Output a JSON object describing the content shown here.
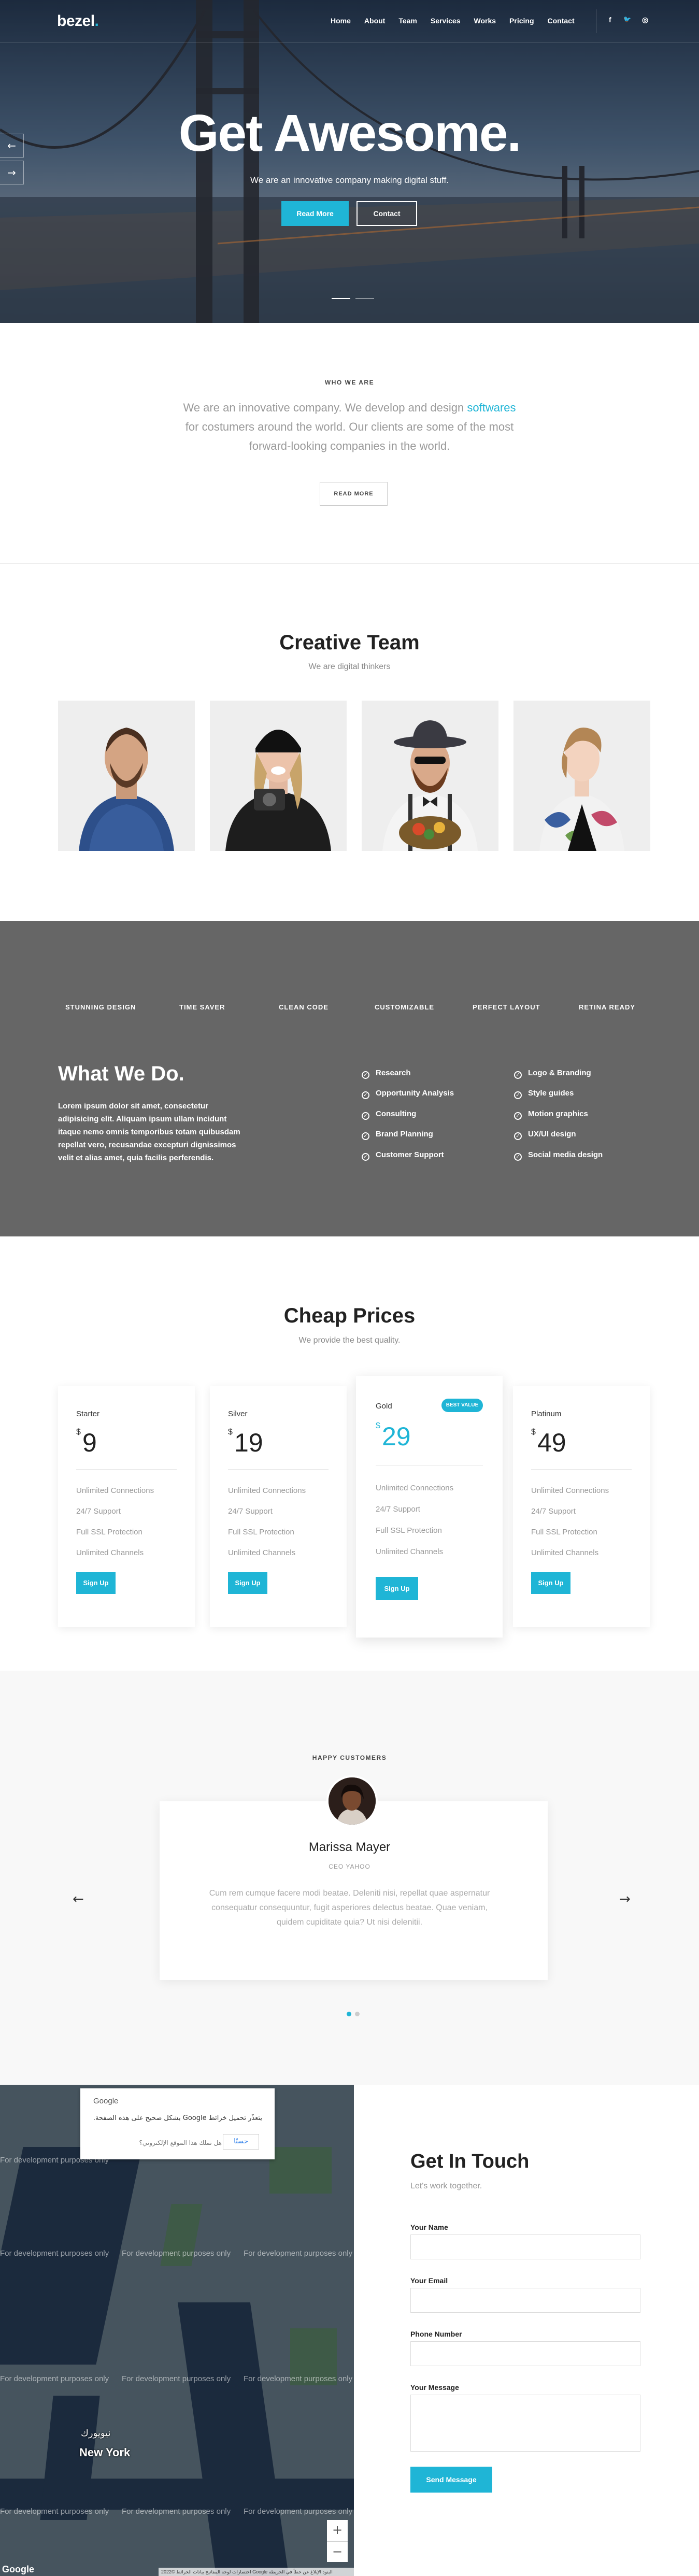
{
  "nav": {
    "logo": "bezel",
    "logo_dot": ".",
    "items": [
      {
        "label": "Home"
      },
      {
        "label": "About"
      },
      {
        "label": "Team"
      },
      {
        "label": "Services"
      },
      {
        "label": "Works"
      },
      {
        "label": "Pricing"
      },
      {
        "label": "Contact"
      }
    ],
    "social": [
      {
        "icon": "facebook-icon",
        "glyph": "f"
      },
      {
        "icon": "twitter-icon",
        "glyph": "🐦"
      },
      {
        "icon": "instagram-icon",
        "glyph": "◎"
      }
    ]
  },
  "hero": {
    "title": "Get Awesome.",
    "subtitle": "We are an innovative company making digital stuff.",
    "read_more": "Read More",
    "contact": "Contact",
    "prev_arrow": "←",
    "next_arrow": "→",
    "slides": 2,
    "active_slide": 1
  },
  "about": {
    "label": "WHO WE ARE",
    "text_before": "We are an innovative company. We develop and design ",
    "highlight": "softwares",
    "text_after": " for costumers around the world. Our clients are some of the most forward-looking companies in the world.",
    "read_more": "READ MORE"
  },
  "team": {
    "title": "Creative Team",
    "subtitle": "We are digital thinkers",
    "members": [
      {
        "photo": "man in blue plaid shirt"
      },
      {
        "photo": "woman with beanie and camera"
      },
      {
        "photo": "bearded man with hat and sunglasses"
      },
      {
        "photo": "woman in floral top"
      }
    ]
  },
  "features": {
    "tabs": [
      "STUNNING DESIGN",
      "TIME SAVER",
      "CLEAN CODE",
      "CUSTOMIZABLE",
      "PERFECT LAYOUT",
      "RETINA READY"
    ],
    "title": "What We Do.",
    "text": "Lorem ipsum dolor sit amet, consectetur adipisicing elit. Aliquam ipsum ullam incidunt itaque nemo omnis temporibus totam quibusdam repellat vero, recusandae excepturi dignissimos velit et alias amet, quia facilis perferendis.",
    "list_left": [
      "Research",
      "Opportunity Analysis",
      "Consulting",
      "Brand Planning",
      "Customer Support"
    ],
    "list_right": [
      "Logo & Branding",
      "Style guides",
      "Motion graphics",
      "UX/UI design",
      "Social media design"
    ],
    "check_glyph": "✓",
    "bg_color": "#666666"
  },
  "pricing": {
    "title": "Cheap Prices",
    "subtitle": "We provide the best quality.",
    "plans": [
      {
        "name": "Starter",
        "currency": "$",
        "price": "9",
        "features": [
          "Unlimited Connections",
          "24/7 Support",
          "Full SSL Protection",
          "Unlimited Channels"
        ],
        "button": "Sign Up"
      },
      {
        "name": "Silver",
        "currency": "$",
        "price": "19",
        "features": [
          "Unlimited Connections",
          "24/7 Support",
          "Full SSL Protection",
          "Unlimited Channels"
        ],
        "button": "Sign Up"
      },
      {
        "name": "Gold",
        "currency": "$",
        "price": "29",
        "badge": "BEST VALUE",
        "features": [
          "Unlimited Connections",
          "24/7 Support",
          "Full SSL Protection",
          "Unlimited Channels"
        ],
        "button": "Sign Up"
      },
      {
        "name": "Platinum",
        "currency": "$",
        "price": "49",
        "features": [
          "Unlimited Connections",
          "24/7 Support",
          "Full SSL Protection",
          "Unlimited Channels"
        ],
        "button": "Sign Up"
      }
    ],
    "accent": "#1fb5d6"
  },
  "testimonial": {
    "label": "HAPPY CUSTOMERS",
    "name": "Marissa Mayer",
    "role": "CEO YAHOO",
    "quote": "Cum rem cumque facere modi beatae. Deleniti nisi, repellat quae aspernatur consequatur consequuntur, fugit asperiores delectus beatae. Quae veniam, quidem cupiditate quia? Ut nisi delenitii.",
    "prev": "←",
    "next": "→",
    "slides": 2,
    "active_slide": 1
  },
  "map": {
    "dialog_brand": "Google",
    "dialog_message": "يتعذّر تحميل خرائط Google بشكل صحيح على هذه الصفحة.",
    "dialog_link": "هل تملك هذا الموقع الإلكتروني؟",
    "dialog_ok": "حسنًا",
    "watermark": "For development purposes only",
    "city": "New York",
    "city_ar": "نيويورك",
    "zoom_in": "+",
    "zoom_out": "−",
    "footer": "اختصارات لوحة المفاتيح  بيانات الخرائط ©2022 Google  البنود  الإبلاغ عن خطأ في الخريطة",
    "google_logo": "Google"
  },
  "contact": {
    "title": "Get In Touch",
    "subtitle": "Let's work together.",
    "fields": [
      {
        "label": "Your Name"
      },
      {
        "label": "Your Email"
      },
      {
        "label": "Phone Number"
      },
      {
        "label": "Your Message"
      }
    ],
    "send": "Send Message"
  }
}
